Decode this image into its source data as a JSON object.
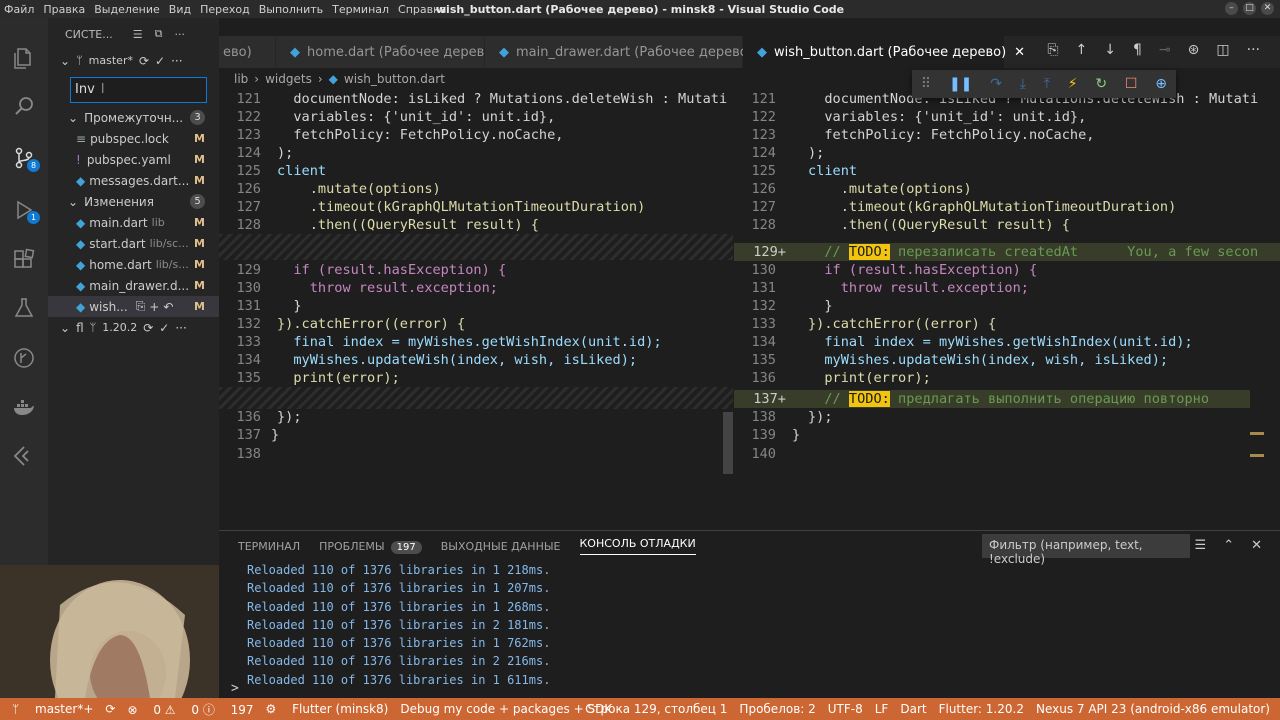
{
  "window": {
    "title": "wish_button.dart (Рабочее дерево) - minsk8 - Visual Studio Code",
    "menu": [
      "Файл",
      "Правка",
      "Выделение",
      "Вид",
      "Переход",
      "Выполнить",
      "Терминал",
      "Справка"
    ]
  },
  "activity": {
    "scm_badge": "8",
    "debug_badge": "1"
  },
  "sidebar": {
    "header": "СИСТЕ...",
    "repo1": "master*",
    "commit_value": "Inv",
    "staged_label": "Промежуточн...",
    "staged_count": "3",
    "staged": [
      {
        "name": "pubspec.lock",
        "status": "M"
      },
      {
        "name": "pubspec.yaml",
        "status": "M"
      },
      {
        "name": "messages.dart...",
        "status": "M"
      }
    ],
    "changes_label": "Изменения",
    "changes_count": "5",
    "changes": [
      {
        "name": "main.dart",
        "path": "lib",
        "status": "M"
      },
      {
        "name": "start.dart",
        "path": "lib/sc...",
        "status": "M"
      },
      {
        "name": "home.dart",
        "path": "lib/s...",
        "status": "M"
      },
      {
        "name": "main_drawer.d...",
        "path": "",
        "status": "M"
      },
      {
        "name": "wish...",
        "path": "",
        "status": "M"
      }
    ],
    "repo2": "fl",
    "repo2_version": "1.20.2"
  },
  "tabs": [
    {
      "label": "ево)"
    },
    {
      "label": "home.dart (Рабочее дерево)"
    },
    {
      "label": "main_drawer.dart (Рабочее дерево)"
    },
    {
      "label": "wish_button.dart (Рабочее дерево)"
    }
  ],
  "breadcrumb": [
    "lib",
    "widgets",
    "wish_button.dart"
  ],
  "left_pane": {
    "lines": [
      {
        "n": "121",
        "code": "  documentNode: isLiked ? Mutations.deleteWish : Mutati"
      },
      {
        "n": "122",
        "code": "  variables: {'unit_id': unit.id},"
      },
      {
        "n": "123",
        "code": "  fetchPolicy: FetchPolicy.noCache,"
      },
      {
        "n": "124",
        "code": ");"
      },
      {
        "n": "125",
        "code": "client"
      },
      {
        "n": "126",
        "code": "    .mutate(options)"
      },
      {
        "n": "127",
        "code": "    .timeout(kGraphQLMutationTimeoutDuration)"
      },
      {
        "n": "128",
        "code": "    .then((QueryResult result) {"
      },
      {
        "n": "",
        "code": ""
      },
      {
        "n": "129",
        "code": "  if (result.hasException) {"
      },
      {
        "n": "130",
        "code": "    throw result.exception;"
      },
      {
        "n": "131",
        "code": "  }"
      },
      {
        "n": "132",
        "code": "}).catchError((error) {"
      },
      {
        "n": "133",
        "code": "  final index = myWishes.getWishIndex(unit.id);"
      },
      {
        "n": "134",
        "code": "  myWishes.updateWish(index, wish, isLiked);"
      },
      {
        "n": "135",
        "code": "  print(error);"
      },
      {
        "n": "",
        "code": ""
      },
      {
        "n": "136",
        "code": "});"
      },
      {
        "n": "137",
        "code": "}"
      },
      {
        "n": "138",
        "code": ""
      }
    ]
  },
  "right_pane": {
    "lines": [
      {
        "n": "121",
        "code": "  documentNode: isLiked ? Mutations.deleteWish : Mutati"
      },
      {
        "n": "122",
        "code": "  variables: {'unit_id': unit.id},"
      },
      {
        "n": "123",
        "code": "  fetchPolicy: FetchPolicy.noCache,"
      },
      {
        "n": "124",
        "code": ");"
      },
      {
        "n": "125",
        "code": "client"
      },
      {
        "n": "126",
        "code": "    .mutate(options)"
      },
      {
        "n": "127",
        "code": "    .timeout(kGraphQLMutationTimeoutDuration)"
      },
      {
        "n": "128",
        "code": "    .then((QueryResult result) {"
      },
      {
        "n": "129+",
        "code": "  // TODO: перезаписать createdAt      You, a few secon"
      },
      {
        "n": "130",
        "code": "  if (result.hasException) {"
      },
      {
        "n": "131",
        "code": "    throw result.exception;"
      },
      {
        "n": "132",
        "code": "  }"
      },
      {
        "n": "133",
        "code": "}).catchError((error) {"
      },
      {
        "n": "134",
        "code": "  final index = myWishes.getWishIndex(unit.id);"
      },
      {
        "n": "135",
        "code": "  myWishes.updateWish(index, wish, isLiked);"
      },
      {
        "n": "136",
        "code": "  print(error);"
      },
      {
        "n": "137+",
        "code": "  // TODO: предлагать выполнить операцию повторно"
      },
      {
        "n": "138",
        "code": "});"
      },
      {
        "n": "139",
        "code": "}"
      },
      {
        "n": "140",
        "code": ""
      }
    ]
  },
  "panel": {
    "tabs": [
      "ТЕРМИНАЛ",
      "ПРОБЛЕМЫ",
      "ВЫХОДНЫЕ ДАННЫЕ",
      "КОНСОЛЬ ОТЛАДКИ"
    ],
    "problems_count": "197",
    "filter_placeholder": "Фильтр (например, text, !exclude)",
    "console": [
      "Reloaded 110 of 1376 libraries in 1 218ms.",
      "Reloaded 110 of 1376 libraries in 1 207ms.",
      "Reloaded 110 of 1376 libraries in 1 268ms.",
      "Reloaded 110 of 1376 libraries in 2 181ms.",
      "Reloaded 110 of 1376 libraries in 1 762ms.",
      "Reloaded 110 of 1376 libraries in 2 216ms.",
      "Reloaded 110 of 1376 libraries in 1 611ms."
    ],
    "prompt": ">"
  },
  "status": {
    "branch": "master*+",
    "sync": "⟳",
    "errors": "0",
    "warnings": "0",
    "infos": "197",
    "flutter": "Flutter (minsk8)",
    "debug": "Debug my code + packages + SDK",
    "position": "Строка 129, столбец 1",
    "spaces": "Пробелов: 2",
    "encoding": "UTF-8",
    "eol": "LF",
    "lang": "Dart",
    "flutter_ver": "Flutter: 1.20.2",
    "device": "Nexus 7 API 23 (android-x86 emulator)"
  },
  "colors": {
    "accent": "#0e7ad3",
    "statusbar": "#cc6633",
    "todo": "#f1c40f"
  }
}
